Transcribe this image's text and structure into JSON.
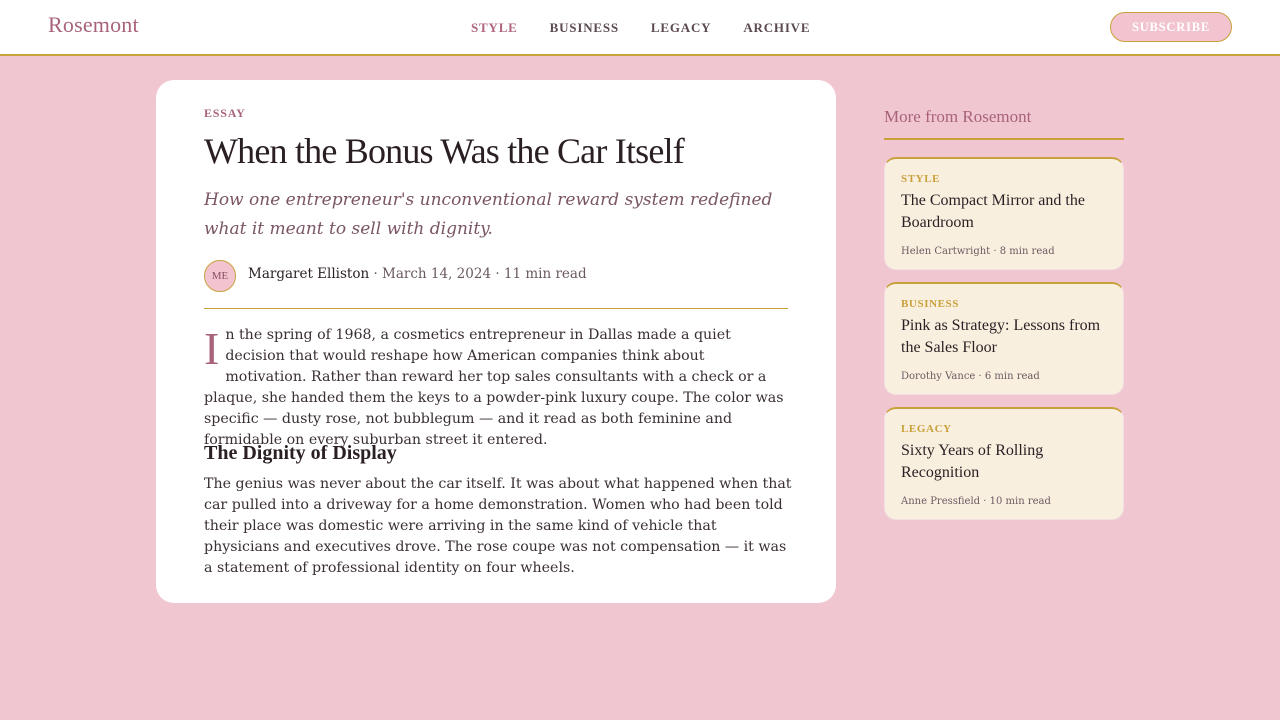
{
  "header": {
    "brand": "Rosemont",
    "nav": [
      "STYLE",
      "BUSINESS",
      "LEGACY",
      "ARCHIVE"
    ],
    "active_nav": "STYLE",
    "subscribe_label": "SUBSCRIBE"
  },
  "article": {
    "kicker": "ESSAY",
    "title": "When the Bonus Was the Car Itself",
    "dek": "How one entrepreneur's unconventional reward system redefined what it meant to sell with dignity.",
    "avatar_initials": "ME",
    "author": "Margaret Elliston",
    "byline_rest": " · March 14, 2024 · 11 min read",
    "dropcap": "I",
    "paragraph1": "n the spring of 1968, a cosmetics entrepreneur in Dallas made a quiet decision that would reshape how American companies think about motivation. Rather than reward her top sales consultants with a check or a plaque, she handed them the keys to a powder-pink luxury coupe. The color was specific — dusty rose, not bubblegum — and it read as both feminine and formidable on every suburban street it entered.",
    "subheading": "The Dignity of Display",
    "paragraph2": "The genius was never about the car itself. It was about what happened when that car pulled into a driveway for a home demonstration. Women who had been told their place was domestic were arriving in the same kind of vehicle that physicians and executives drove. The rose coupe was not compensation — it was a statement of professional identity on four wheels."
  },
  "sidebar": {
    "title": "More from Rosemont",
    "stories": [
      {
        "category": "STYLE",
        "title": "The Compact Mirror and the Boardroom",
        "meta": "Helen Cartwright · 8 min read"
      },
      {
        "category": "BUSINESS",
        "title": "Pink as Strategy: Lessons from the Sales Floor",
        "meta": "Dorothy Vance · 6 min read"
      },
      {
        "category": "LEGACY",
        "title": "Sixty Years of Rolling Recognition",
        "meta": "Anne Pressfield · 10 min read"
      }
    ]
  },
  "colors": {
    "background": "#f0c6d0",
    "accent_rose": "#a8637a",
    "accent_gold": "#c9a13b",
    "card_cream": "#f9efdf"
  }
}
